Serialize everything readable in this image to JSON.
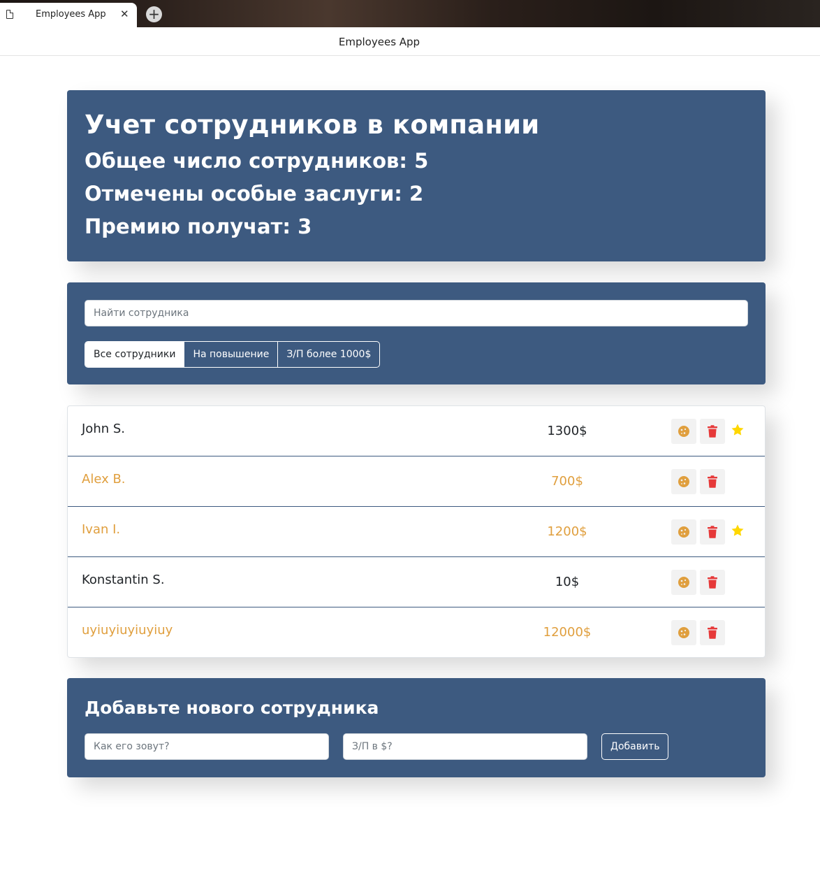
{
  "browser": {
    "tab_title": "Employees App",
    "tab_close": "✕",
    "new_tab": "+",
    "window_title": "Employees App"
  },
  "app_info": {
    "heading": "Учет сотрудников в компании",
    "total": "Общее число сотрудников: 5",
    "merit": "Отмечены особые заслуги: 2",
    "bonus": "Премию получат: 3"
  },
  "search": {
    "placeholder": "Найти сотрудника",
    "filters": [
      "Все сотрудники",
      "На повышение",
      "З/П более 1000$"
    ],
    "active_filter": "Все сотрудники"
  },
  "employees": [
    {
      "name": "John S.",
      "salary": "1300$",
      "increase": false,
      "star": true
    },
    {
      "name": "Alex B.",
      "salary": "700$",
      "increase": true,
      "star": false
    },
    {
      "name": "Ivan I.",
      "salary": "1200$",
      "increase": true,
      "star": true
    },
    {
      "name": "Konstantin S.",
      "salary": "10$",
      "increase": false,
      "star": false
    },
    {
      "name": "uyiuyiuyiuyiuy",
      "salary": "12000$",
      "increase": true,
      "star": false
    }
  ],
  "add_form": {
    "heading": "Добавьте нового сотрудника",
    "name_placeholder": "Как его зовут?",
    "salary_placeholder": "З/П в $?",
    "submit_label": "Добавить"
  },
  "colors": {
    "panel": "#3d5a80",
    "increase": "#e09f3e",
    "trash": "#e63939",
    "star": "#ffd700"
  },
  "icons": {
    "cookie": "cookie-icon",
    "trash": "trash-icon",
    "star": "star-icon"
  }
}
